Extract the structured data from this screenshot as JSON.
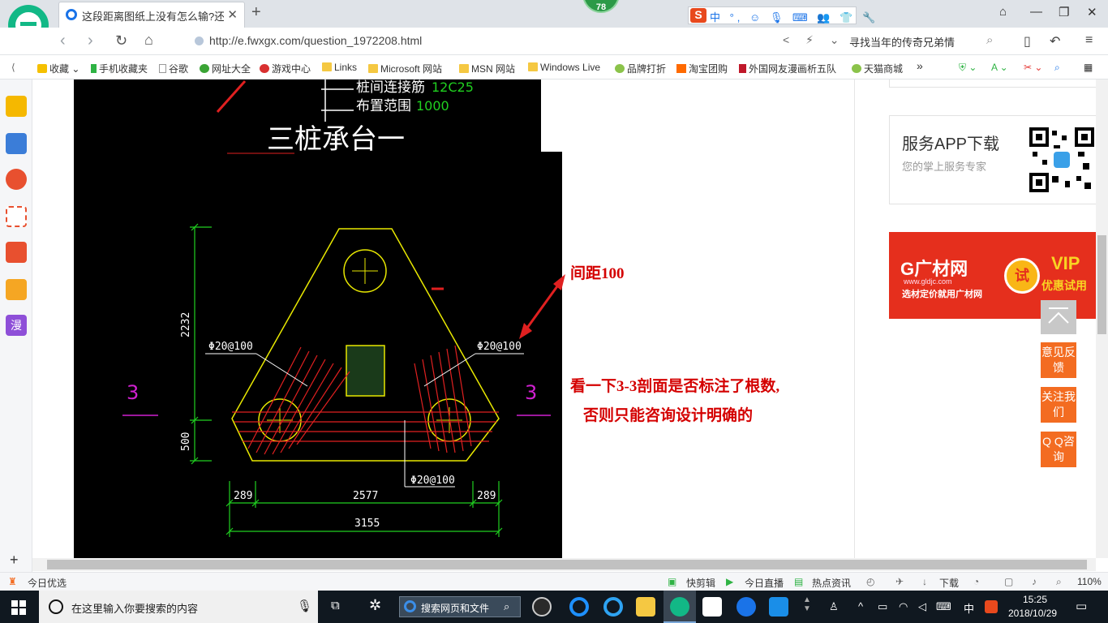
{
  "tab": {
    "title": "这段距离图纸上没有怎么输?还",
    "close": "✕",
    "new": "+"
  },
  "badge": "78",
  "ime": {
    "logo": "S",
    "items": "中 °, ☺ 🎙 ⌨ 👥 👕 🔧"
  },
  "window": {
    "min": "—",
    "max": "❐",
    "close": "✕",
    "pin": "⌂"
  },
  "address": {
    "url": "http://e.fwxgx.com/question_1972208.html",
    "search_text": "寻找当年的传奇兄弟情",
    "right_icons": "< ⚡ ⌄"
  },
  "bookmarks": {
    "items": [
      "收藏",
      "手机收藏夹",
      "谷歌",
      "网址大全",
      "游戏中心",
      "Links",
      "Microsoft 网站",
      "MSN 网站",
      "Windows Live",
      "品牌打折",
      "淘宝团购",
      "外国网友漫画析五队",
      "天猫商城"
    ],
    "more": "»"
  },
  "cad": {
    "note_line1": "桩间连接筋",
    "note_val1": "12C25",
    "note_line2": "布置范围",
    "note_val2": "1000",
    "heading": "三桩承台一",
    "rebar_left": "Φ20@100",
    "rebar_right": "Φ20@100",
    "rebar_bottom": "Φ20@100",
    "section_left": "3",
    "section_right": "3",
    "dim_height_1": "2232",
    "dim_height_2": "500",
    "dim_left": "289",
    "dim_mid": "2577",
    "dim_right": "289",
    "dim_total": "3155"
  },
  "annotations": {
    "spacing": "间距100",
    "line1": "看一下3-3剖面是否标注了根数,",
    "line2": "否则只能咨询设计明确的"
  },
  "sidebar_right": {
    "app_title": "服务APP下载",
    "app_desc": "您的掌上服务专家",
    "ad_logo": "G广材网",
    "ad_url": "www.gldjc.com",
    "ad_slogan": "选材定价就用广材网",
    "ad_try": "试",
    "ad_vip": "VIP",
    "ad_vip_sub": "优惠试用",
    "feedback": "意见反馈",
    "follow": "关注我们",
    "qq": "Q Q咨询"
  },
  "statusbar": {
    "left": "今日优选",
    "items": [
      "快剪辑",
      "今日直播",
      "热点资讯"
    ],
    "download": "下载",
    "zoom": "110%"
  },
  "taskbar": {
    "search_placeholder": "在这里输入你要搜索的内容",
    "web_search": "搜索网页和文件",
    "ime": "中",
    "time": "15:25",
    "date": "2018/10/29"
  },
  "colors": {
    "accent_green": "#12b886",
    "cad_yellow": "#e8e800",
    "cad_red": "#e02020",
    "cad_green": "#20d020",
    "annotation_red": "#d40000",
    "ad_red": "#e52f1d",
    "side_orange": "#f36c21"
  }
}
